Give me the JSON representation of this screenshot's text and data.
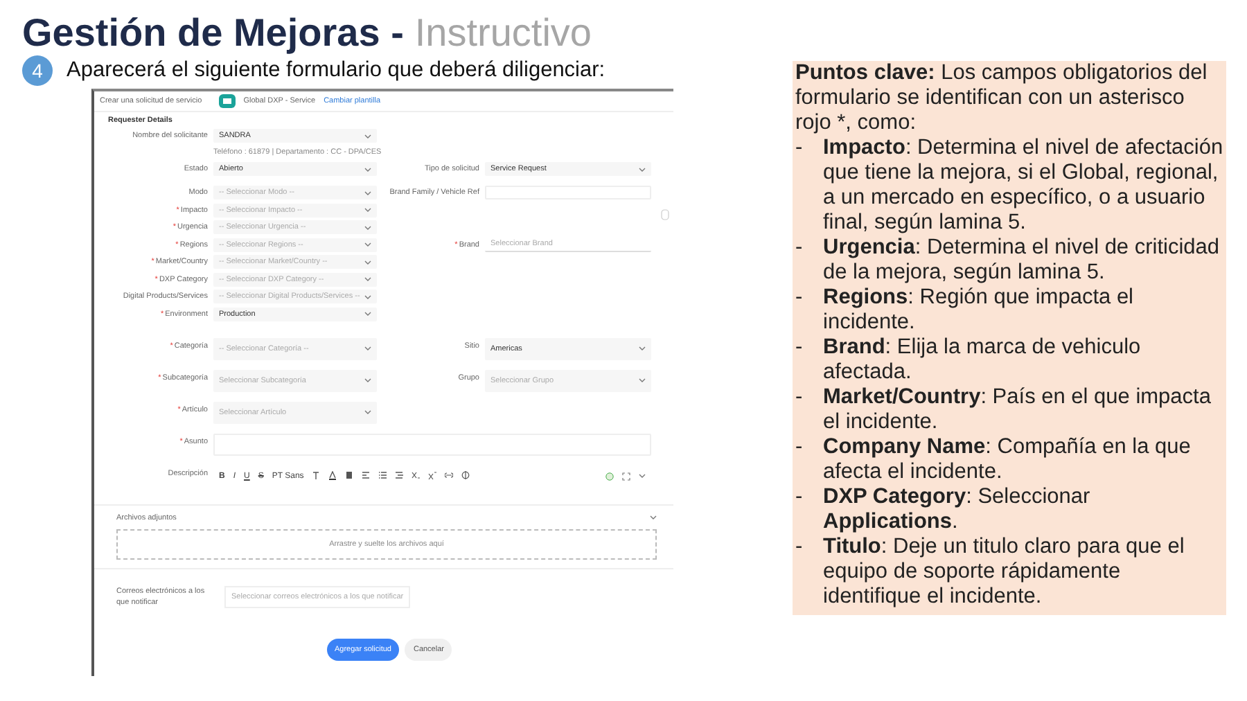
{
  "title": {
    "main": "Gestión de Mejoras -",
    "sub": "Instructivo"
  },
  "step": {
    "number": "4",
    "text": "Aparecerá el siguiente formulario que deberá diligenciar:"
  },
  "form": {
    "header": {
      "title": "Crear una solicitud de servicio",
      "service": "Global DXP - Service",
      "link": "Cambiar plantilla"
    },
    "required_mark": "*",
    "section": "Requester Details",
    "requester": {
      "label": "Nombre del solicitante",
      "value": "SANDRA",
      "info": "Teléfono : 61879  |  Departamento : CC - DPA/CES"
    },
    "details": [
      {
        "left": {
          "label": "Estado",
          "required": false,
          "kind": "select",
          "value": "Abierto"
        },
        "right": {
          "label": "Tipo de solicitud",
          "required": false,
          "kind": "select",
          "value": "Service Request"
        }
      },
      {
        "left": {
          "label": "Modo",
          "required": false,
          "kind": "select",
          "placeholder": "-- Seleccionar Modo --"
        },
        "right": {
          "label": "Brand Family / Vehicle Ref",
          "required": false,
          "kind": "textarea"
        }
      },
      {
        "left": {
          "label": "Impacto",
          "required": true,
          "kind": "select",
          "placeholder": "-- Seleccionar Impacto --"
        }
      },
      {
        "left": {
          "label": "Urgencia",
          "required": true,
          "kind": "select",
          "placeholder": "-- Seleccionar Urgencia --"
        }
      },
      {
        "left": {
          "label": "Regions",
          "required": true,
          "kind": "select",
          "placeholder": "-- Seleccionar Regions --"
        },
        "right": {
          "label": "Brand",
          "required": true,
          "kind": "text",
          "placeholder": "Seleccionar Brand"
        }
      },
      {
        "left": {
          "label": "Market/Country",
          "required": true,
          "kind": "select",
          "placeholder": "-- Seleccionar Market/Country --"
        }
      },
      {
        "left": {
          "label": "DXP Category",
          "required": true,
          "kind": "select",
          "placeholder": "-- Seleccionar DXP Category --"
        }
      },
      {
        "left": {
          "label": "Digital Products/Services",
          "required": false,
          "kind": "select",
          "placeholder": "-- Seleccionar Digital Products/Services --"
        }
      },
      {
        "left": {
          "label": "Environment",
          "required": true,
          "kind": "select",
          "value": "Production"
        }
      }
    ],
    "classification": [
      {
        "left": {
          "label": "Categoría",
          "required": true,
          "kind": "select",
          "placeholder": "-- Seleccionar Categoría --"
        },
        "right": {
          "label": "Sitio",
          "required": false,
          "kind": "select",
          "value": "Americas"
        }
      },
      {
        "left": {
          "label": "Subcategoría",
          "required": true,
          "kind": "select",
          "placeholder": "Seleccionar Subcategoría"
        },
        "right": {
          "label": "Grupo",
          "required": false,
          "kind": "select",
          "placeholder": "Seleccionar Grupo"
        }
      },
      {
        "left": {
          "label": "Artículo",
          "required": true,
          "kind": "select",
          "placeholder": "Seleccionar Artículo"
        }
      },
      {
        "left": {
          "label": "Asunto",
          "required": true,
          "kind": "wide"
        }
      },
      {
        "left": {
          "label": "Descripción",
          "required": false,
          "kind": "editor",
          "toolbar": [
            "B",
            "I",
            "U",
            "S",
            "PT Sans"
          ]
        }
      }
    ],
    "attachments": {
      "title": "Archivos adjuntos",
      "dropzone": "Arrastre y suelte los archivos aquí"
    },
    "notify": {
      "label": "Correos electrónicos a los que notificar",
      "placeholder": "Seleccionar correos electrónicos a los que notificar"
    },
    "buttons": [
      {
        "label": "Agregar solicitud",
        "kind": "primary"
      },
      {
        "label": "Cancelar",
        "kind": "secondary"
      }
    ]
  },
  "key_points": {
    "intro": "**Puntos clave:** Los campos obligatorios del formulario se identifican con un asterisco rojo *, como:",
    "items": [
      {
        "bullet": "-",
        "text": "**Impacto**:  Determina el nivel de afectación que tiene la mejora, si el Global, regional, a un mercado en específico, o a usuario final, según lamina 5."
      },
      {
        "bullet": "-",
        "text": "**Urgencia**: Determina el nivel de criticidad de la mejora, según lamina 5."
      },
      {
        "bullet": "-",
        "text": "**Regions**: Región que impacta el incidente."
      },
      {
        "bullet": "-",
        "text": "**Brand**: Elija la marca de vehiculo afectada."
      },
      {
        "bullet": "-",
        "text": "**Market/Country**: País  en el que impacta el incidente."
      },
      {
        "bullet": "-",
        "text": "**Company Name**: Compañía en la que afecta el incidente."
      },
      {
        "bullet": "-",
        "text": "**DXP Category**: Seleccionar **Applications**."
      },
      {
        "bullet": "-",
        "text": "**Titulo**: Deje un titulo claro para que el equipo de soporte rápidamente identifique el incidente."
      }
    ]
  }
}
